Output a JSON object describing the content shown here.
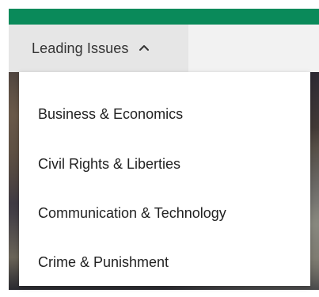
{
  "nav": {
    "trigger_label": "Leading Issues",
    "expanded": true
  },
  "dropdown": {
    "items": [
      {
        "label": "Business & Economics"
      },
      {
        "label": "Civil Rights & Liberties"
      },
      {
        "label": "Communication & Technology"
      },
      {
        "label": "Crime & Punishment"
      }
    ]
  },
  "colors": {
    "brand_bar": "#0a8a5a",
    "nav_background": "#f2f2f2",
    "trigger_background": "#e6e6e6",
    "menu_background": "#ffffff",
    "text": "#222222"
  },
  "icons": {
    "trigger_icon": "chevron-up-icon"
  }
}
